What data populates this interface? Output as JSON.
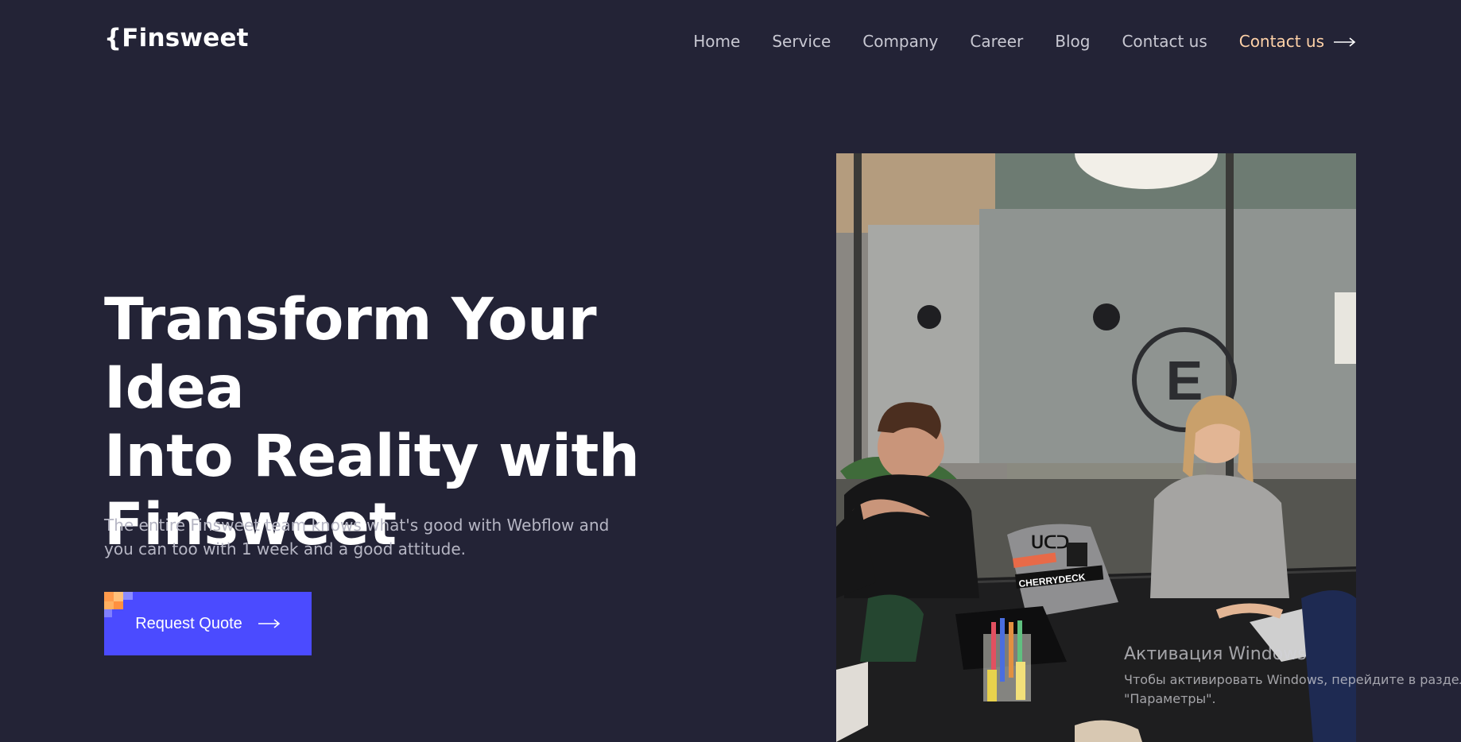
{
  "brand": {
    "logo": "{Finsweet"
  },
  "nav": {
    "items": [
      "Home",
      "Service",
      "Company",
      "Career",
      "Blog",
      "Contact us"
    ],
    "cta_label": "Contact us",
    "cta_color": "#ffd2a8"
  },
  "hero": {
    "headline_lines": [
      "Transform Your Idea",
      "Into Reality with",
      "Finsweet"
    ],
    "subtext_lines": [
      "The entire Finsweet team knows what's good with Webflow and",
      "you can too with 1 week and a good attitude."
    ],
    "cta_label": "Request Quote",
    "cta_color": "#4b4bff",
    "image_icon": "team-meeting-photo",
    "photo_sticker_texts": [
      "CHERRYDECK"
    ]
  },
  "watermark": {
    "title": "Активация Windows",
    "line1": "Чтобы активировать Windows, перейдите в раздел",
    "line2": "\"Параметры\"."
  },
  "colors": {
    "background": "#232336",
    "headline": "#ffffff",
    "subtext": "#b6b6c4"
  }
}
